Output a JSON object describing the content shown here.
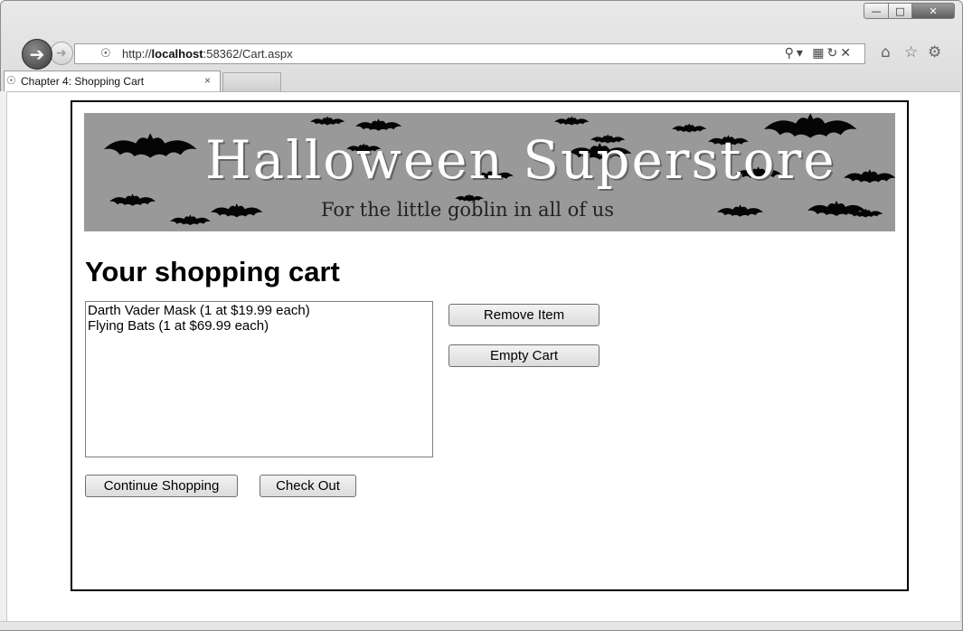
{
  "browser": {
    "url_prefix": "http://",
    "url_host": "localhost",
    "url_rest": ":58362/Cart.aspx",
    "tab_title": "Chapter 4: Shopping Cart",
    "tab_close": "×",
    "icons": [
      "back-icon",
      "forward-icon",
      "ie-icon",
      "search-icon",
      "compat-icon",
      "refresh-icon",
      "stop-icon",
      "home-icon",
      "favorites-icon",
      "settings-icon"
    ]
  },
  "banner": {
    "title": "Halloween Superstore",
    "tagline": "For the little goblin in all of us",
    "background": "#999999"
  },
  "cart": {
    "heading": "Your shopping cart",
    "items": [
      "Darth Vader Mask (1 at $19.99 each)",
      "Flying Bats (1 at $69.99 each)"
    ],
    "remove_label": "Remove Item",
    "empty_label": "Empty Cart",
    "continue_label": "Continue Shopping",
    "checkout_label": "Check Out"
  }
}
